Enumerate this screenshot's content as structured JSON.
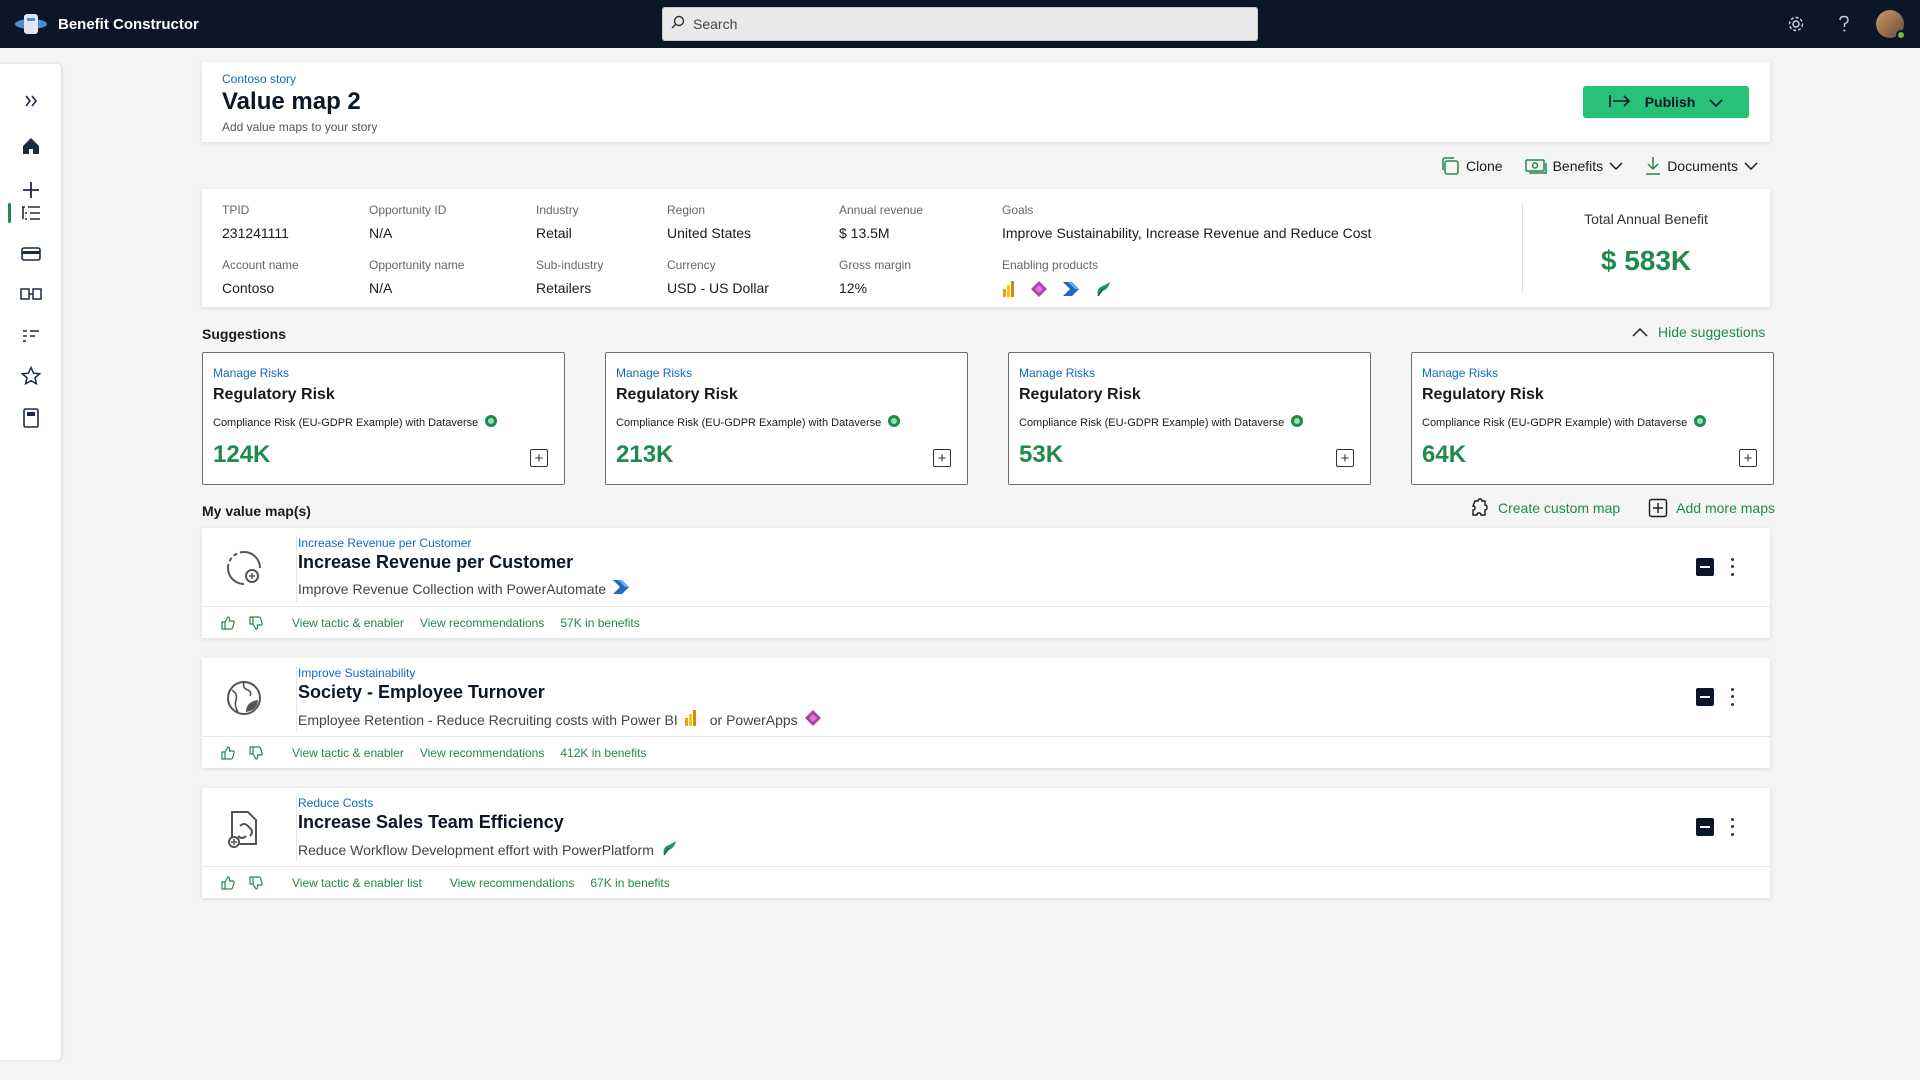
{
  "app": {
    "title": "Benefit Constructor"
  },
  "search": {
    "placeholder": "Search"
  },
  "header": {
    "story": "Contoso story",
    "title": "Value map 2",
    "subtitle": "Add value maps to your story",
    "publish_label": "Publish"
  },
  "toolbar": {
    "clone": "Clone",
    "benefits": "Benefits",
    "documents": "Documents"
  },
  "info": {
    "tpid": {
      "label": "TPID",
      "value": "231241111"
    },
    "opportunity_id": {
      "label": "Opportunity ID",
      "value": "N/A"
    },
    "industry": {
      "label": "Industry",
      "value": "Retail"
    },
    "region": {
      "label": "Region",
      "value": "United States"
    },
    "annual_revenue": {
      "label": "Annual revenue",
      "value": "$ 13.5M"
    },
    "account_name": {
      "label": "Account name",
      "value": "Contoso"
    },
    "opportunity_name": {
      "label": "Opportunity name",
      "value": "N/A"
    },
    "sub_industry": {
      "label": "Sub-industry",
      "value": "Retailers"
    },
    "currency": {
      "label": "Currency",
      "value": "USD - US Dollar"
    },
    "gross_margin": {
      "label": "Gross margin",
      "value": "12%"
    },
    "goals": {
      "label": "Goals",
      "part1": "Improve Sustainability, Increase Revenue",
      "and": " and ",
      "part2": "Reduce Cost"
    },
    "enabling_products": {
      "label": "Enabling products",
      "icons": [
        "power-bi-icon",
        "power-apps-icon",
        "power-automate-icon",
        "power-platform-icon"
      ]
    },
    "total_label": "Total Annual Benefit",
    "total_value": "$ 583K"
  },
  "suggestions": {
    "title": "Suggestions",
    "hide_label": "Hide suggestions",
    "cards": [
      {
        "category": "Manage Risks",
        "title": "Regulatory Risk",
        "desc": "Compliance Risk (EU-GDPR Example) with Dataverse",
        "value": "124K"
      },
      {
        "category": "Manage Risks",
        "title": "Regulatory Risk",
        "desc": "Compliance Risk (EU-GDPR Example) with Dataverse",
        "value": "213K"
      },
      {
        "category": "Manage Risks",
        "title": "Regulatory Risk",
        "desc": "Compliance Risk (EU-GDPR Example) with Dataverse",
        "value": "53K"
      },
      {
        "category": "Manage Risks",
        "title": "Regulatory Risk",
        "desc": "Compliance Risk (EU-GDPR Example) with Dataverse",
        "value": "64K"
      }
    ]
  },
  "value_maps": {
    "title": "My value map(s)",
    "create_label": "Create custom map",
    "add_label": "Add more maps",
    "items": [
      {
        "category": "Increase Revenue per Customer",
        "title": "Increase Revenue per Customer",
        "desc": "Improve Revenue Collection with PowerAutomate",
        "desc2": "",
        "link1": "View tactic & enabler",
        "link2": "View recommendations",
        "benefits": "57K in benefits"
      },
      {
        "category": "Improve Sustainability",
        "title": "Society - Employee Turnover",
        "desc": "Employee Retention - Reduce Recruiting costs with Power BI",
        "desc2": "or PowerApps",
        "link1": "View tactic & enabler",
        "link2": "View recommendations",
        "benefits": "412K in benefits"
      },
      {
        "category": "Reduce Costs",
        "title": "Increase Sales Team Efficiency",
        "desc": "Reduce Workflow Development effort with PowerPlatform",
        "desc2": "",
        "link1": "View tactic & enabler list",
        "link2": "View recommendations",
        "benefits": "67K in benefits"
      }
    ]
  },
  "colors": {
    "accent": "#1f8a4c",
    "link": "#0f6cbd",
    "topbar": "#0b1628",
    "publish": "#27c17a"
  }
}
